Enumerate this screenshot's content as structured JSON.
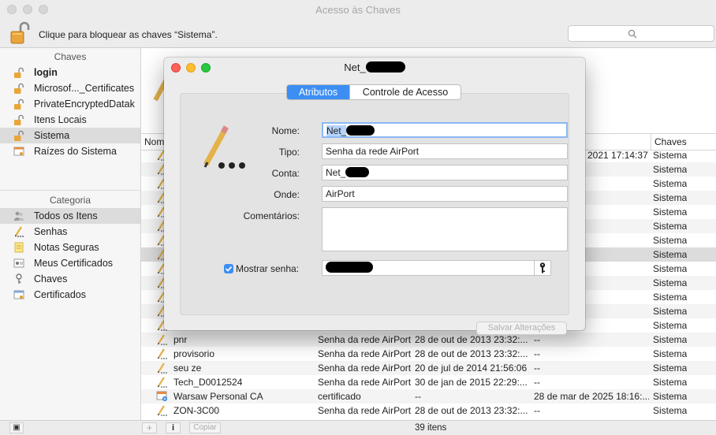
{
  "window": {
    "title": "Acesso às Chaves"
  },
  "toolbar": {
    "lock_text": "Clique para bloquear as chaves “Sistema”."
  },
  "sidebar": {
    "keychains_header": "Chaves",
    "keychains": [
      {
        "label": "login",
        "icon": "lock-open-icon",
        "bold": true
      },
      {
        "label": "Microsof..._Certificates",
        "icon": "lock-open-icon"
      },
      {
        "label": "PrivateEncryptedDatak",
        "icon": "lock-open-icon"
      },
      {
        "label": "Itens Locais",
        "icon": "lock-open-icon"
      },
      {
        "label": "Sistema",
        "icon": "lock-open-icon",
        "selected": true
      },
      {
        "label": "Raízes do Sistema",
        "icon": "certificate-icon"
      }
    ],
    "category_header": "Categoria",
    "categories": [
      {
        "label": "Todos os Itens",
        "icon": "people-icon",
        "selected": true
      },
      {
        "label": "Senhas",
        "icon": "pencil-icon"
      },
      {
        "label": "Notas Seguras",
        "icon": "note-icon"
      },
      {
        "label": "Meus Certificados",
        "icon": "certificate-icon"
      },
      {
        "label": "Chaves",
        "icon": "key-icon"
      },
      {
        "label": "Certificados",
        "icon": "certificate-icon"
      }
    ]
  },
  "list": {
    "columns": {
      "name": "Nome",
      "keychain": "Chaves"
    },
    "top_rows_keychain": "Sistema",
    "first_row_date_fragment": "2021 17:14:37",
    "rows": [
      {
        "name": "pnr",
        "kind": "Senha da rede AirPort",
        "modified": "28 de out de 2013 23:32:...",
        "expires": "--",
        "keychain": "Sistema"
      },
      {
        "name": "provisorio",
        "kind": "Senha da rede AirPort",
        "modified": "28 de out de 2013 23:32:...",
        "expires": "--",
        "keychain": "Sistema"
      },
      {
        "name": "seu ze",
        "kind": "Senha da rede AirPort",
        "modified": "20 de jul de 2014 21:56:06",
        "expires": "--",
        "keychain": "Sistema"
      },
      {
        "name": "Tech_D0012524",
        "kind": "Senha da rede AirPort",
        "modified": "30 de jan de 2015 22:29:...",
        "expires": "--",
        "keychain": "Sistema"
      },
      {
        "name": "Warsaw Personal CA",
        "kind": "certificado",
        "modified": "--",
        "expires": "28 de mar de 2025 18:16:...",
        "keychain": "Sistema"
      },
      {
        "name": "ZON-3C00",
        "kind": "Senha da rede AirPort",
        "modified": "28 de out de 2013 23:32:...",
        "expires": "--",
        "keychain": "Sistema"
      }
    ]
  },
  "bottom": {
    "copy_label": "Copiar",
    "info_label": "i",
    "add_label": "+",
    "count": "39 itens"
  },
  "dialog": {
    "title": "Net_",
    "tabs": [
      {
        "label": "Atributos",
        "active": true
      },
      {
        "label": "Controle de Acesso",
        "active": false
      }
    ],
    "labels": {
      "name": "Nome:",
      "kind": "Tipo:",
      "account": "Conta:",
      "where": "Onde:",
      "comments": "Comentários:",
      "show_password": "Mostrar senha:"
    },
    "values": {
      "name": "Net_",
      "kind": "Senha da rede AirPort",
      "account": "Net_",
      "where": "AirPort",
      "comments": "",
      "password": ""
    },
    "show_password_checked": true,
    "save_label": "Salvar Alterações"
  },
  "colors": {
    "accent": "#3d8ef3",
    "close": "#fe5f57",
    "minimize": "#febc2e",
    "zoom": "#28c840"
  }
}
